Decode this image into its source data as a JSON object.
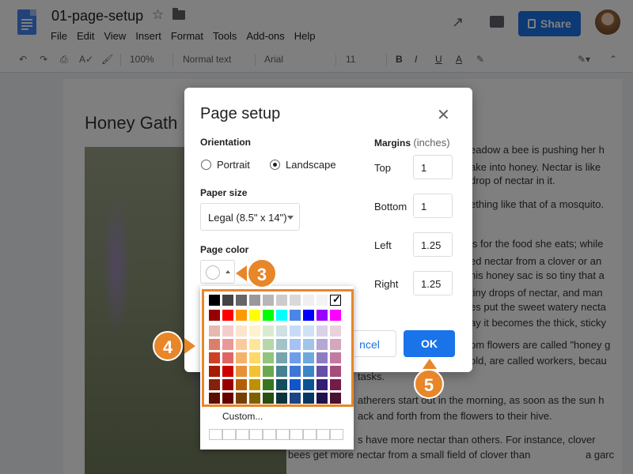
{
  "header": {
    "doc_title": "01-page-setup",
    "share_label": "Share",
    "menu": [
      "File",
      "Edit",
      "View",
      "Insert",
      "Format",
      "Tools",
      "Add-ons",
      "Help"
    ]
  },
  "toolbar": {
    "zoom": "100%",
    "style": "Normal text",
    "font": "Arial",
    "size": "11",
    "bold": "B",
    "italic": "I",
    "underline": "U",
    "text_color": "A"
  },
  "document": {
    "heading": "Honey Gath",
    "lines": [
      "eadow a bee is pushing her h",
      "ake into honey. Nectar is like",
      "drop of nectar in it.",
      "ething like that of a mosquito.",
      "is for the food she eats; while",
      "ed nectar from a clover or an",
      "his honey sac is so tiny that a",
      "tiny drops of nectar, and man",
      "es put the sweet watery necta",
      "ay it becomes the thick, sticky",
      "om flowers are called \"honey g",
      "old, are called workers, becau",
      "tasks.",
      "atherers start out in the morning, as soon as the sun h",
      "ack and forth from the flowers to their hive.",
      "s have more nectar than others. For instance, clover",
      "bees get more nectar from a small field of clover than",
      "a garc"
    ]
  },
  "dialog": {
    "title": "Page setup",
    "orientation_label": "Orientation",
    "portrait_label": "Portrait",
    "landscape_label": "Landscape",
    "orientation_selected": "Landscape",
    "paper_size_label": "Paper size",
    "paper_size_value": "Legal (8.5\" x 14\")",
    "page_color_label": "Page color",
    "margins_label": "Margins",
    "margins_unit": "(inches)",
    "margins": [
      {
        "label": "Top",
        "value": "1"
      },
      {
        "label": "Bottom",
        "value": "1"
      },
      {
        "label": "Left",
        "value": "1.25"
      },
      {
        "label": "Right",
        "value": "1.25"
      }
    ],
    "cancel_label": "ncel",
    "ok_label": "OK"
  },
  "palette": {
    "custom_label": "Custom...",
    "selected_color": "#ffffff",
    "gray_row": [
      "#000000",
      "#434343",
      "#666666",
      "#999999",
      "#b7b7b7",
      "#cccccc",
      "#d9d9d9",
      "#efefef",
      "#f3f3f3",
      "#ffffff"
    ],
    "bright_row": [
      "#980000",
      "#ff0000",
      "#ff9900",
      "#ffff00",
      "#00ff00",
      "#00ffff",
      "#4a86e8",
      "#0000ff",
      "#9900ff",
      "#ff00ff"
    ],
    "shade_rows": [
      [
        "#e6b8af",
        "#f4cccc",
        "#fce5cd",
        "#fff2cc",
        "#d9ead3",
        "#d0e0e3",
        "#c9daf8",
        "#cfe2f3",
        "#d9d2e9",
        "#ead1dc"
      ],
      [
        "#dd7e6b",
        "#ea9999",
        "#f9cb9c",
        "#ffe599",
        "#b6d7a8",
        "#a2c4c9",
        "#a4c2f4",
        "#9fc5e8",
        "#b4a7d6",
        "#d5a6bd"
      ],
      [
        "#cc4125",
        "#e06666",
        "#f6b26b",
        "#ffd966",
        "#93c47d",
        "#76a5af",
        "#6d9eeb",
        "#6fa8dc",
        "#8e7cc3",
        "#c27ba0"
      ],
      [
        "#a61c00",
        "#cc0000",
        "#e69138",
        "#f1c232",
        "#6aa84f",
        "#45818e",
        "#3c78d8",
        "#3d85c6",
        "#674ea7",
        "#a64d79"
      ],
      [
        "#85200c",
        "#990000",
        "#b45f06",
        "#bf9000",
        "#38761d",
        "#134f5c",
        "#1155cc",
        "#0b5394",
        "#351c75",
        "#741b47"
      ],
      [
        "#5b0f00",
        "#660000",
        "#783f04",
        "#7f6000",
        "#274e13",
        "#0c343d",
        "#1c4587",
        "#073763",
        "#20124d",
        "#4c1130"
      ]
    ]
  },
  "callouts": {
    "step3": "3",
    "step4": "4",
    "step5": "5"
  },
  "colors": {
    "accent": "#1a73e8",
    "callout": "#e8862a"
  }
}
